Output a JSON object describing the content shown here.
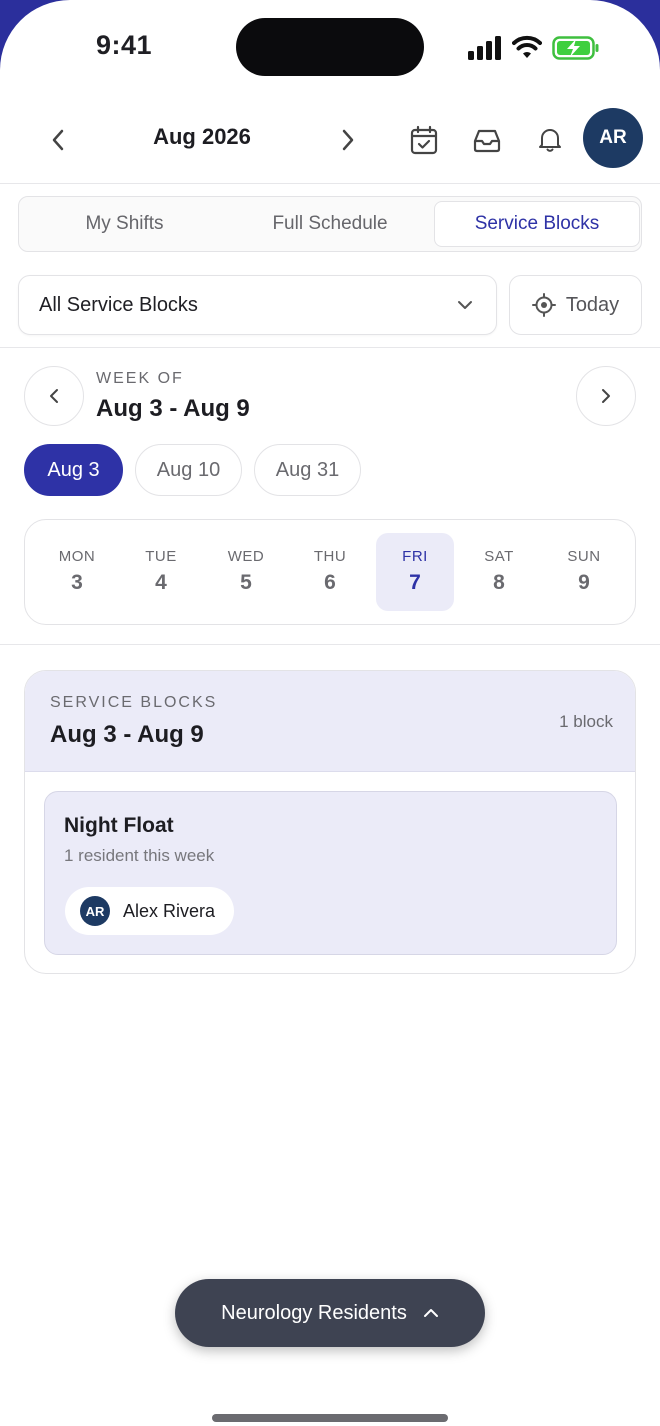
{
  "status_bar": {
    "time": "9:41"
  },
  "header": {
    "month": "Aug 2026",
    "avatar_initials": "AR",
    "icons": [
      "chevron-left-icon",
      "chevron-right-icon",
      "calendar-check-icon",
      "inbox-icon",
      "bell-icon"
    ]
  },
  "tabs": [
    {
      "label": "My Shifts",
      "active": false
    },
    {
      "label": "Full Schedule",
      "active": false
    },
    {
      "label": "Service Blocks",
      "active": true
    }
  ],
  "filter": {
    "selected": "All Service Blocks",
    "today_label": "Today"
  },
  "week": {
    "kicker": "WEEK OF",
    "range": "Aug 3 - Aug 9",
    "chips": [
      {
        "label": "Aug 3",
        "active": true
      },
      {
        "label": "Aug 10",
        "active": false
      },
      {
        "label": "Aug 31",
        "active": false
      }
    ],
    "days": [
      {
        "name": "MON",
        "num": "3"
      },
      {
        "name": "TUE",
        "num": "4"
      },
      {
        "name": "WED",
        "num": "5"
      },
      {
        "name": "THU",
        "num": "6"
      },
      {
        "name": "FRI",
        "num": "7"
      },
      {
        "name": "SAT",
        "num": "8"
      },
      {
        "name": "SUN",
        "num": "9"
      }
    ],
    "selected_day": "FRI"
  },
  "service_blocks": {
    "kicker": "SERVICE BLOCKS",
    "range": "Aug 3 - Aug 9",
    "count": "1 block",
    "blocks": [
      {
        "name": "Night Float",
        "subtitle": "1 resident this week",
        "residents": [
          {
            "initials": "AR",
            "name": "Alex Rivera"
          }
        ]
      }
    ]
  },
  "group_selector": {
    "label": "Neurology Residents"
  },
  "colors": {
    "accent": "#2e32a6",
    "avatar": "#1d3a63",
    "highlight_bg": "#ebebf8",
    "pill_bg": "#3e4352"
  }
}
